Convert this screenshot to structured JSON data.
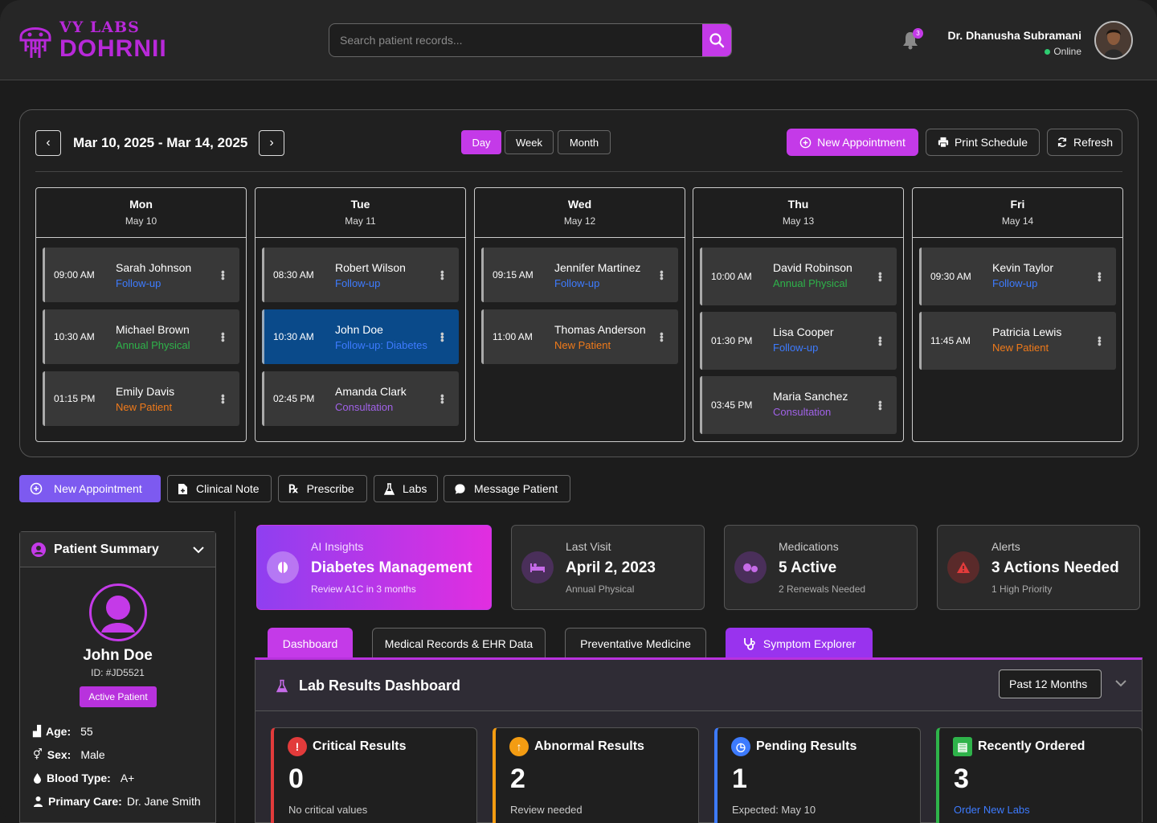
{
  "brand": {
    "small": "VY LABS",
    "big": "DOHRNII",
    "accent": "#c43ae8"
  },
  "search": {
    "placeholder": "Search patient records..."
  },
  "notifications": {
    "count": "3"
  },
  "user": {
    "name": "Dr. Dhanusha Subramani",
    "status": "Online"
  },
  "schedule": {
    "range": "Mar 10, 2025 - Mar 14, 2025",
    "views": [
      "Day",
      "Week",
      "Month"
    ],
    "active_view": "Day",
    "new_appointment": "New Appointment",
    "print": "Print Schedule",
    "refresh": "Refresh",
    "days": [
      {
        "name": "Mon",
        "date": "May 10",
        "appointments": [
          {
            "time": "09:00 AM",
            "patient": "Sarah Johnson",
            "type": "Follow-up"
          },
          {
            "time": "10:30 AM",
            "patient": "Michael Brown",
            "type": "Annual Physical"
          },
          {
            "time": "01:15 PM",
            "patient": "Emily Davis",
            "type": "New Patient"
          }
        ]
      },
      {
        "name": "Tue",
        "date": "May 11",
        "appointments": [
          {
            "time": "08:30 AM",
            "patient": "Robert Wilson",
            "type": "Follow-up"
          },
          {
            "time": "10:30 AM",
            "patient": "John Doe",
            "type": "Follow-up: Diabetes"
          },
          {
            "time": "02:45 PM",
            "patient": "Amanda Clark",
            "type": "Consultation"
          }
        ]
      },
      {
        "name": "Wed",
        "date": "May 12",
        "appointments": [
          {
            "time": "09:15 AM",
            "patient": "Jennifer Martinez",
            "type": "Follow-up"
          },
          {
            "time": "11:00 AM",
            "patient": "Thomas Anderson",
            "type": "New Patient"
          }
        ]
      },
      {
        "name": "Thu",
        "date": "May 13",
        "appointments": [
          {
            "time": "10:00 AM",
            "patient": "David Robinson",
            "type": "Annual Physical"
          },
          {
            "time": "01:30 PM",
            "patient": "Lisa Cooper",
            "type": "Follow-up"
          },
          {
            "time": "03:45 PM",
            "patient": "Maria Sanchez",
            "type": "Consultation"
          }
        ]
      },
      {
        "name": "Fri",
        "date": "May 14",
        "appointments": [
          {
            "time": "09:30 AM",
            "patient": "Kevin Taylor",
            "type": "Follow-up"
          },
          {
            "time": "11:45 AM",
            "patient": "Patricia Lewis",
            "type": "New Patient"
          }
        ]
      }
    ]
  },
  "actions": [
    "New Appointment",
    "Clinical Note",
    "Prescribe",
    "Labs",
    "Message Patient"
  ],
  "patient": {
    "section_title": "Patient Summary",
    "name": "John Doe",
    "id": "ID: #JD5521",
    "badge": "Active Patient",
    "age_label": "Age:",
    "age": "55",
    "sex_label": "Sex:",
    "sex": "Male",
    "blood_label": "Blood Type:",
    "blood": "A+",
    "care_label": "Primary Care:",
    "care": "Dr. Jane Smith"
  },
  "cards": [
    {
      "label": "AI Insights",
      "value": "Diabetes Management",
      "sub": "Review A1C in 3 months"
    },
    {
      "label": "Last Visit",
      "value": "April 2, 2023",
      "sub": "Annual Physical"
    },
    {
      "label": "Medications",
      "value": "5 Active",
      "sub": "2 Renewals Needed"
    },
    {
      "label": "Alerts",
      "value": "3 Actions Needed",
      "sub": "1 High Priority"
    }
  ],
  "tabs": [
    "Dashboard",
    "Medical Records & EHR Data",
    "Preventative Medicine",
    "Symptom Explorer"
  ],
  "lab": {
    "title": "Lab Results Dashboard",
    "period": "Past 12 Months",
    "cards": [
      {
        "title": "Critical Results",
        "value": "0",
        "sub": "No critical values",
        "color": "#e23b3b"
      },
      {
        "title": "Abnormal Results",
        "value": "2",
        "sub": "Review needed",
        "color": "#f39c12"
      },
      {
        "title": "Pending Results",
        "value": "1",
        "sub": "Expected: May 10",
        "color": "#3d7bff"
      },
      {
        "title": "Recently Ordered",
        "value": "3",
        "sub": "Order New Labs",
        "color": "#2eb34a"
      }
    ]
  }
}
